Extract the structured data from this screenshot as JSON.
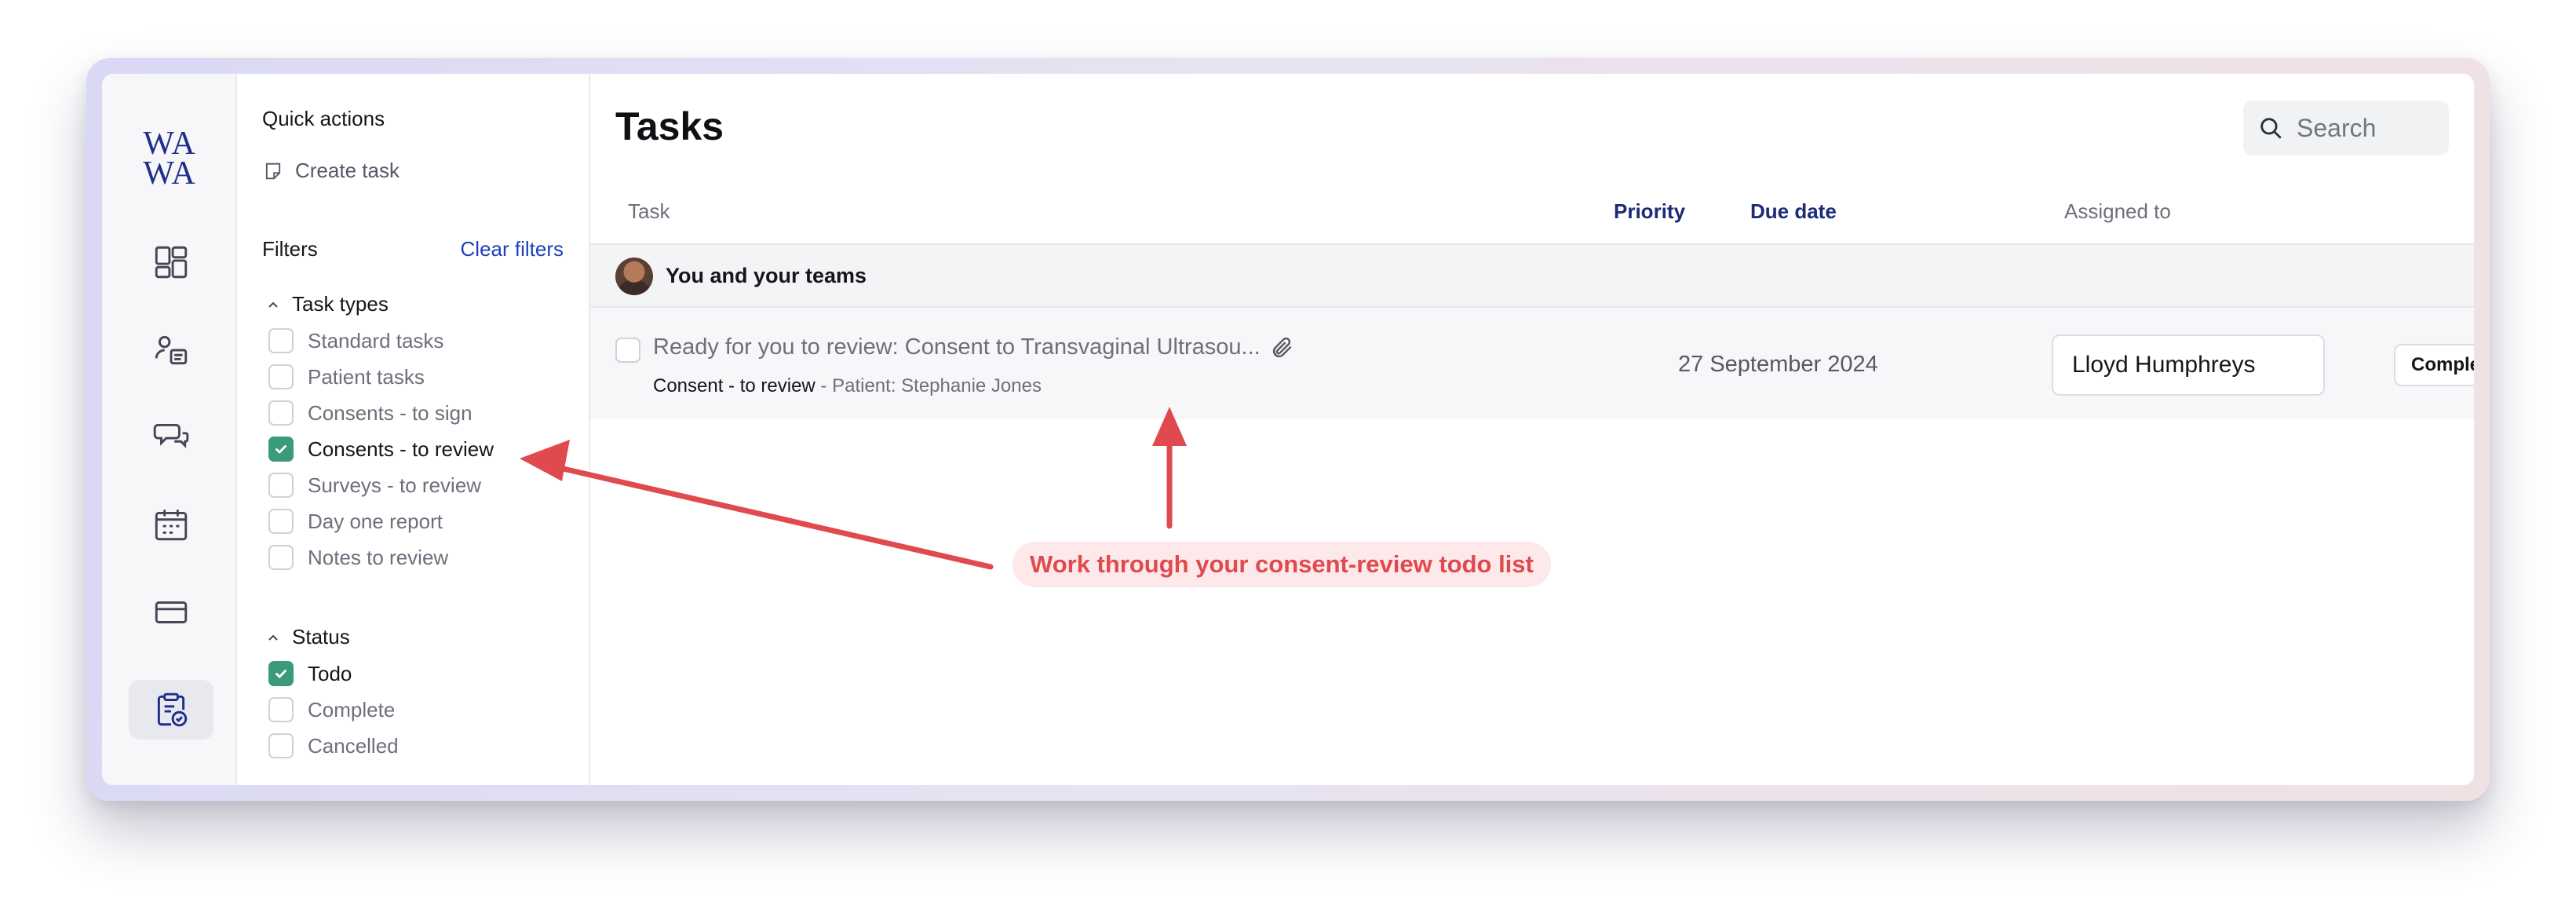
{
  "logo": {
    "line1": "WA",
    "line2": "WA"
  },
  "rail": {
    "items": [
      {
        "icon": "dashboard-icon"
      },
      {
        "icon": "patient-list-icon"
      },
      {
        "icon": "messages-icon"
      },
      {
        "icon": "calendar-icon"
      },
      {
        "icon": "payments-card-icon"
      },
      {
        "icon": "tasks-clipboard-icon",
        "active": true
      }
    ]
  },
  "sidebar": {
    "quick_actions_label": "Quick actions",
    "create_task_label": "Create task",
    "filters_label": "Filters",
    "clear_filters_label": "Clear filters",
    "task_types": {
      "heading": "Task types",
      "options": [
        {
          "label": "Standard tasks",
          "checked": false
        },
        {
          "label": "Patient tasks",
          "checked": false
        },
        {
          "label": "Consents - to sign",
          "checked": false
        },
        {
          "label": "Consents - to review",
          "checked": true
        },
        {
          "label": "Surveys - to review",
          "checked": false
        },
        {
          "label": "Day one report",
          "checked": false
        },
        {
          "label": "Notes to review",
          "checked": false
        }
      ]
    },
    "status": {
      "heading": "Status",
      "options": [
        {
          "label": "Todo",
          "checked": true
        },
        {
          "label": "Complete",
          "checked": false
        },
        {
          "label": "Cancelled",
          "checked": false
        }
      ]
    }
  },
  "main": {
    "title": "Tasks",
    "search_placeholder": "Search",
    "columns": {
      "task": "Task",
      "priority": "Priority",
      "due_date": "Due date",
      "assigned_to": "Assigned to"
    },
    "group_label": "You and your teams",
    "task": {
      "title": "Ready for you to review: Consent to Transvaginal Ultrasou...",
      "type": "Consent - to review",
      "separator": " - ",
      "patient": "Patient: Stephanie Jones",
      "due_date": "27 September 2024",
      "assignee": "Lloyd Humphreys",
      "complete_label": "Complete"
    }
  },
  "annotation": {
    "text": "Work through your consent-review todo list",
    "color": "#e04a4f"
  },
  "colors": {
    "accent_blue": "#1f3fbf",
    "checkbox_green": "#3b9a7c",
    "logo_navy": "#1f2e8a"
  }
}
